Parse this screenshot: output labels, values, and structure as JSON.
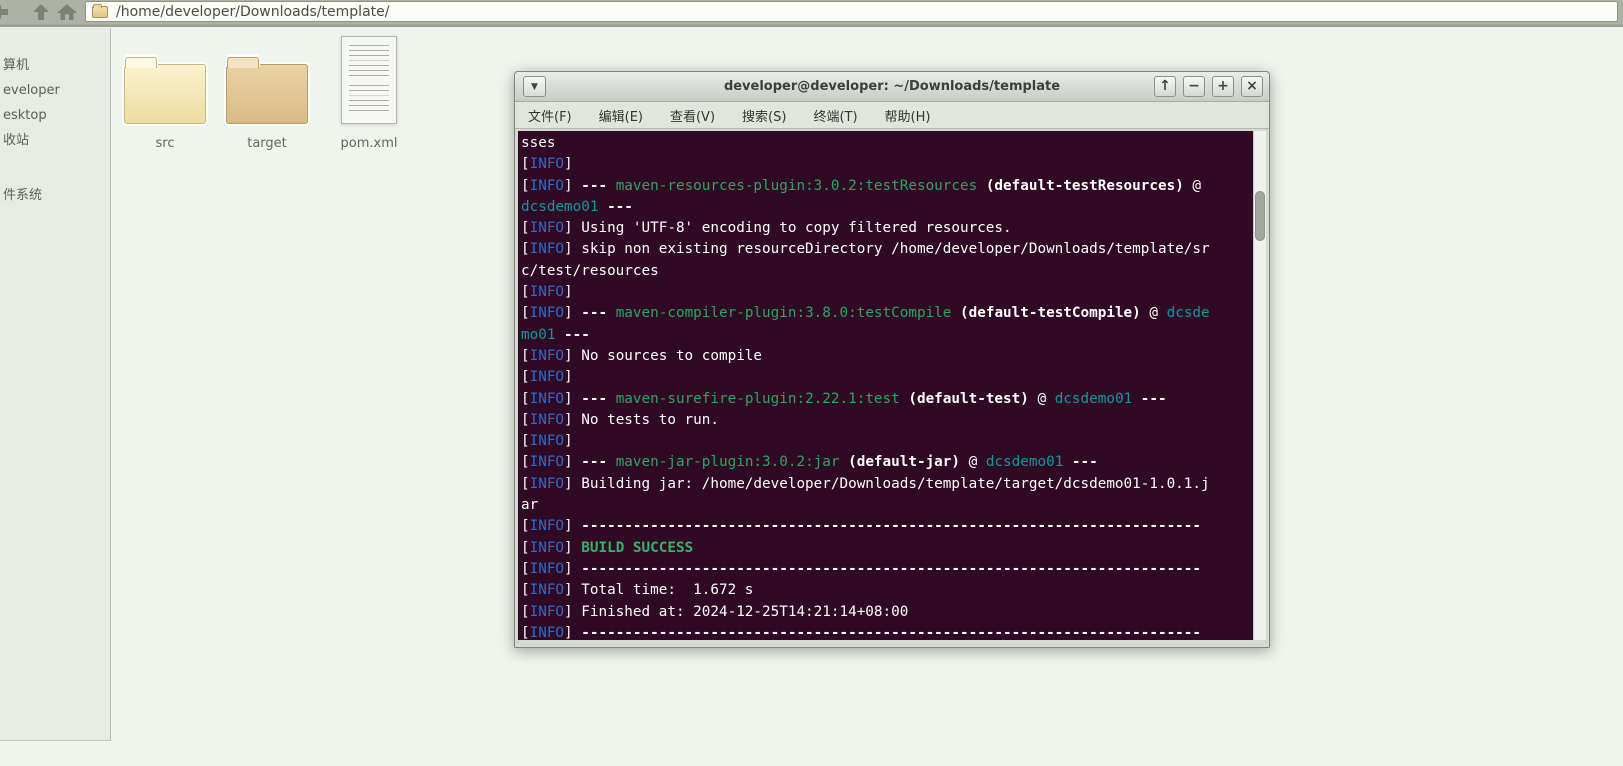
{
  "file_manager": {
    "toolbar": {
      "path_value": "/home/developer/Downloads/template/"
    },
    "sidebar": {
      "items": [
        {
          "label": "算机",
          "gap": false
        },
        {
          "label": "eveloper",
          "gap": false
        },
        {
          "label": "esktop",
          "gap": false
        },
        {
          "label": "收站",
          "gap": false
        },
        {
          "label": "件系统",
          "gap": true
        }
      ]
    },
    "files": [
      {
        "name": "src",
        "type": "folder",
        "variant": "light"
      },
      {
        "name": "target",
        "type": "folder",
        "variant": "dark"
      },
      {
        "name": "pom.xml",
        "type": "document",
        "variant": ""
      }
    ]
  },
  "terminal": {
    "title": "developer@developer: ~/Downloads/template",
    "dropdown_glyph": "▼",
    "menu": [
      "文件(F)",
      "编辑(E)",
      "查看(V)",
      "搜索(S)",
      "终端(T)",
      "帮助(H)"
    ],
    "window_buttons": [
      {
        "name": "shade",
        "glyph": "↑"
      },
      {
        "name": "minimize",
        "glyph": "−"
      },
      {
        "name": "maximize",
        "glyph": "+"
      },
      {
        "name": "close",
        "glyph": "×"
      }
    ],
    "colors": {
      "background": "#300a24",
      "text": "#ffffff",
      "info_blue": "#2a6bd1",
      "plugin_green": "#2fa463",
      "artifact_cyan": "#12989e",
      "success_green": "#33b467"
    },
    "lines": [
      [
        {
          "t": "sses",
          "c": "w"
        }
      ],
      [
        {
          "t": "[",
          "c": "w"
        },
        {
          "t": "INFO",
          "c": "i"
        },
        {
          "t": "]",
          "c": "w"
        }
      ],
      [
        {
          "t": "[",
          "c": "w"
        },
        {
          "t": "INFO",
          "c": "i"
        },
        {
          "t": "] ",
          "c": "w"
        },
        {
          "t": "--- ",
          "c": "b"
        },
        {
          "t": "maven-resources-plugin:3.0.2:testResources",
          "c": "g"
        },
        {
          "t": " ",
          "c": "w"
        },
        {
          "t": "(default-testResources)",
          "c": "b"
        },
        {
          "t": " @",
          "c": "w"
        }
      ],
      [
        {
          "t": "dcsdemo01",
          "c": "c"
        },
        {
          "t": " ",
          "c": "w"
        },
        {
          "t": "---",
          "c": "b"
        }
      ],
      [
        {
          "t": "[",
          "c": "w"
        },
        {
          "t": "INFO",
          "c": "i"
        },
        {
          "t": "] Using 'UTF-8' encoding to copy filtered resources.",
          "c": "w"
        }
      ],
      [
        {
          "t": "[",
          "c": "w"
        },
        {
          "t": "INFO",
          "c": "i"
        },
        {
          "t": "] skip non existing resourceDirectory /home/developer/Downloads/template/sr",
          "c": "w"
        }
      ],
      [
        {
          "t": "c/test/resources",
          "c": "w"
        }
      ],
      [
        {
          "t": "[",
          "c": "w"
        },
        {
          "t": "INFO",
          "c": "i"
        },
        {
          "t": "]",
          "c": "w"
        }
      ],
      [
        {
          "t": "[",
          "c": "w"
        },
        {
          "t": "INFO",
          "c": "i"
        },
        {
          "t": "] ",
          "c": "w"
        },
        {
          "t": "--- ",
          "c": "b"
        },
        {
          "t": "maven-compiler-plugin:3.8.0:testCompile",
          "c": "g"
        },
        {
          "t": " ",
          "c": "w"
        },
        {
          "t": "(default-testCompile)",
          "c": "b"
        },
        {
          "t": " @ ",
          "c": "w"
        },
        {
          "t": "dcsde",
          "c": "c"
        }
      ],
      [
        {
          "t": "mo01",
          "c": "c"
        },
        {
          "t": " ",
          "c": "w"
        },
        {
          "t": "---",
          "c": "b"
        }
      ],
      [
        {
          "t": "[",
          "c": "w"
        },
        {
          "t": "INFO",
          "c": "i"
        },
        {
          "t": "] No sources to compile",
          "c": "w"
        }
      ],
      [
        {
          "t": "[",
          "c": "w"
        },
        {
          "t": "INFO",
          "c": "i"
        },
        {
          "t": "]",
          "c": "w"
        }
      ],
      [
        {
          "t": "[",
          "c": "w"
        },
        {
          "t": "INFO",
          "c": "i"
        },
        {
          "t": "] ",
          "c": "w"
        },
        {
          "t": "--- ",
          "c": "b"
        },
        {
          "t": "maven-surefire-plugin:2.22.1:test",
          "c": "g"
        },
        {
          "t": " ",
          "c": "w"
        },
        {
          "t": "(default-test)",
          "c": "b"
        },
        {
          "t": " @ ",
          "c": "w"
        },
        {
          "t": "dcsdemo01",
          "c": "c"
        },
        {
          "t": " ",
          "c": "w"
        },
        {
          "t": "---",
          "c": "b"
        }
      ],
      [
        {
          "t": "[",
          "c": "w"
        },
        {
          "t": "INFO",
          "c": "i"
        },
        {
          "t": "] No tests to run.",
          "c": "w"
        }
      ],
      [
        {
          "t": "[",
          "c": "w"
        },
        {
          "t": "INFO",
          "c": "i"
        },
        {
          "t": "]",
          "c": "w"
        }
      ],
      [
        {
          "t": "[",
          "c": "w"
        },
        {
          "t": "INFO",
          "c": "i"
        },
        {
          "t": "] ",
          "c": "w"
        },
        {
          "t": "--- ",
          "c": "b"
        },
        {
          "t": "maven-jar-plugin:3.0.2:jar",
          "c": "g"
        },
        {
          "t": " ",
          "c": "w"
        },
        {
          "t": "(default-jar)",
          "c": "b"
        },
        {
          "t": " @ ",
          "c": "w"
        },
        {
          "t": "dcsdemo01",
          "c": "c"
        },
        {
          "t": " ",
          "c": "w"
        },
        {
          "t": "---",
          "c": "b"
        }
      ],
      [
        {
          "t": "[",
          "c": "w"
        },
        {
          "t": "INFO",
          "c": "i"
        },
        {
          "t": "] Building jar: /home/developer/Downloads/template/target/dcsdemo01-1.0.1.j",
          "c": "w"
        }
      ],
      [
        {
          "t": "ar",
          "c": "w"
        }
      ],
      [
        {
          "t": "[",
          "c": "w"
        },
        {
          "t": "INFO",
          "c": "i"
        },
        {
          "t": "] ",
          "c": "w"
        },
        {
          "t": "------------------------------------------------------------------------",
          "c": "b"
        }
      ],
      [
        {
          "t": "[",
          "c": "w"
        },
        {
          "t": "INFO",
          "c": "i"
        },
        {
          "t": "] ",
          "c": "w"
        },
        {
          "t": "BUILD SUCCESS",
          "c": "gb"
        }
      ],
      [
        {
          "t": "[",
          "c": "w"
        },
        {
          "t": "INFO",
          "c": "i"
        },
        {
          "t": "] ",
          "c": "w"
        },
        {
          "t": "------------------------------------------------------------------------",
          "c": "b"
        }
      ],
      [
        {
          "t": "[",
          "c": "w"
        },
        {
          "t": "INFO",
          "c": "i"
        },
        {
          "t": "] Total time:  1.672 s",
          "c": "w"
        }
      ],
      [
        {
          "t": "[",
          "c": "w"
        },
        {
          "t": "INFO",
          "c": "i"
        },
        {
          "t": "] Finished at: 2024-12-25T14:21:14+08:00",
          "c": "w"
        }
      ],
      [
        {
          "t": "[",
          "c": "w"
        },
        {
          "t": "INFO",
          "c": "i"
        },
        {
          "t": "] ",
          "c": "w"
        },
        {
          "t": "------------------------------------------------------------------------",
          "c": "b"
        }
      ]
    ]
  }
}
